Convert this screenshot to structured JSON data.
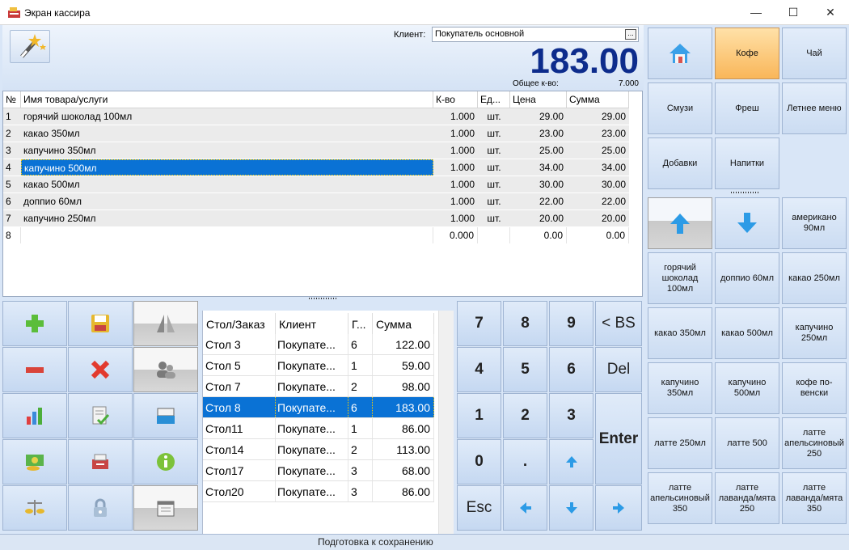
{
  "window": {
    "title": "Экран кассира",
    "minimize": "—",
    "maximize": "☐",
    "close": "✕"
  },
  "header": {
    "client_label": "Клиент:",
    "client_value": "Покупатель основной",
    "client_btn": "...",
    "total": "183.00",
    "qty_label": "Общее к-во:",
    "qty_value": "7.000"
  },
  "grid": {
    "columns": [
      "№",
      "Имя товара/услуги",
      "К-во",
      "Ед...",
      "Цена",
      "Сумма"
    ],
    "rows": [
      {
        "n": "1",
        "name": "горячий шоколад 100мл",
        "qty": "1.000",
        "unit": "шт.",
        "price": "29.00",
        "sum": "29.00"
      },
      {
        "n": "2",
        "name": "какао 350мл",
        "qty": "1.000",
        "unit": "шт.",
        "price": "23.00",
        "sum": "23.00"
      },
      {
        "n": "3",
        "name": "капучино 350мл",
        "qty": "1.000",
        "unit": "шт.",
        "price": "25.00",
        "sum": "25.00"
      },
      {
        "n": "4",
        "name": "капучино 500мл",
        "qty": "1.000",
        "unit": "шт.",
        "price": "34.00",
        "sum": "34.00"
      },
      {
        "n": "5",
        "name": "какао 500мл",
        "qty": "1.000",
        "unit": "шт.",
        "price": "30.00",
        "sum": "30.00"
      },
      {
        "n": "6",
        "name": "доппио 60мл",
        "qty": "1.000",
        "unit": "шт.",
        "price": "22.00",
        "sum": "22.00"
      },
      {
        "n": "7",
        "name": "капучино 250мл",
        "qty": "1.000",
        "unit": "шт.",
        "price": "20.00",
        "sum": "20.00"
      },
      {
        "n": "8",
        "name": "",
        "qty": "0.000",
        "unit": "",
        "price": "0.00",
        "sum": "0.00"
      }
    ]
  },
  "orders": {
    "columns": [
      "Стол/Заказ",
      "Клиент",
      "Г...",
      "Сумма"
    ],
    "rows": [
      {
        "table": "Стол 3",
        "client": "Покупате...",
        "g": "6",
        "sum": "122.00"
      },
      {
        "table": "Стол 5",
        "client": "Покупате...",
        "g": "1",
        "sum": "59.00"
      },
      {
        "table": "Стол 7",
        "client": "Покупате...",
        "g": "2",
        "sum": "98.00"
      },
      {
        "table": "Стол 8",
        "client": "Покупате...",
        "g": "6",
        "sum": "183.00"
      },
      {
        "table": "Стол11",
        "client": "Покупате...",
        "g": "1",
        "sum": "86.00"
      },
      {
        "table": "Стол14",
        "client": "Покупате...",
        "g": "2",
        "sum": "113.00"
      },
      {
        "table": "Стол17",
        "client": "Покупате...",
        "g": "3",
        "sum": "68.00"
      },
      {
        "table": "Стол20",
        "client": "Покупате...",
        "g": "3",
        "sum": "86.00"
      }
    ]
  },
  "numpad": {
    "k7": "7",
    "k8": "8",
    "k9": "9",
    "bs": "< BS",
    "k4": "4",
    "k5": "5",
    "k6": "6",
    "del": "Del",
    "k1": "1",
    "k2": "2",
    "k3": "3",
    "enter": "Enter",
    "k0": "0",
    "dot": ".",
    "esc": "Esc"
  },
  "categories": [
    "Кофе",
    "Чай",
    "Смузи",
    "Фреш",
    "Летнее меню",
    "Добавки",
    "Напитки"
  ],
  "products": [
    "американо 90мл",
    "горячий шоколад 100мл",
    "доппио 60мл",
    "какао 250мл",
    "какао 350мл",
    "какао 500мл",
    "капучино 250мл",
    "капучино 350мл",
    "капучино 500мл",
    "кофе по-венски",
    "латте 250мл",
    "латте 500",
    "латте апельсиновый 250",
    "латте апельсиновый 350",
    "латте лаванда/мята 250",
    "латте лаванда/мята 350"
  ],
  "status": "Подготовка к сохранению",
  "colors": {
    "accent": "#0a72d5",
    "total": "#0d2c8c",
    "active_category": "#f9b659"
  }
}
